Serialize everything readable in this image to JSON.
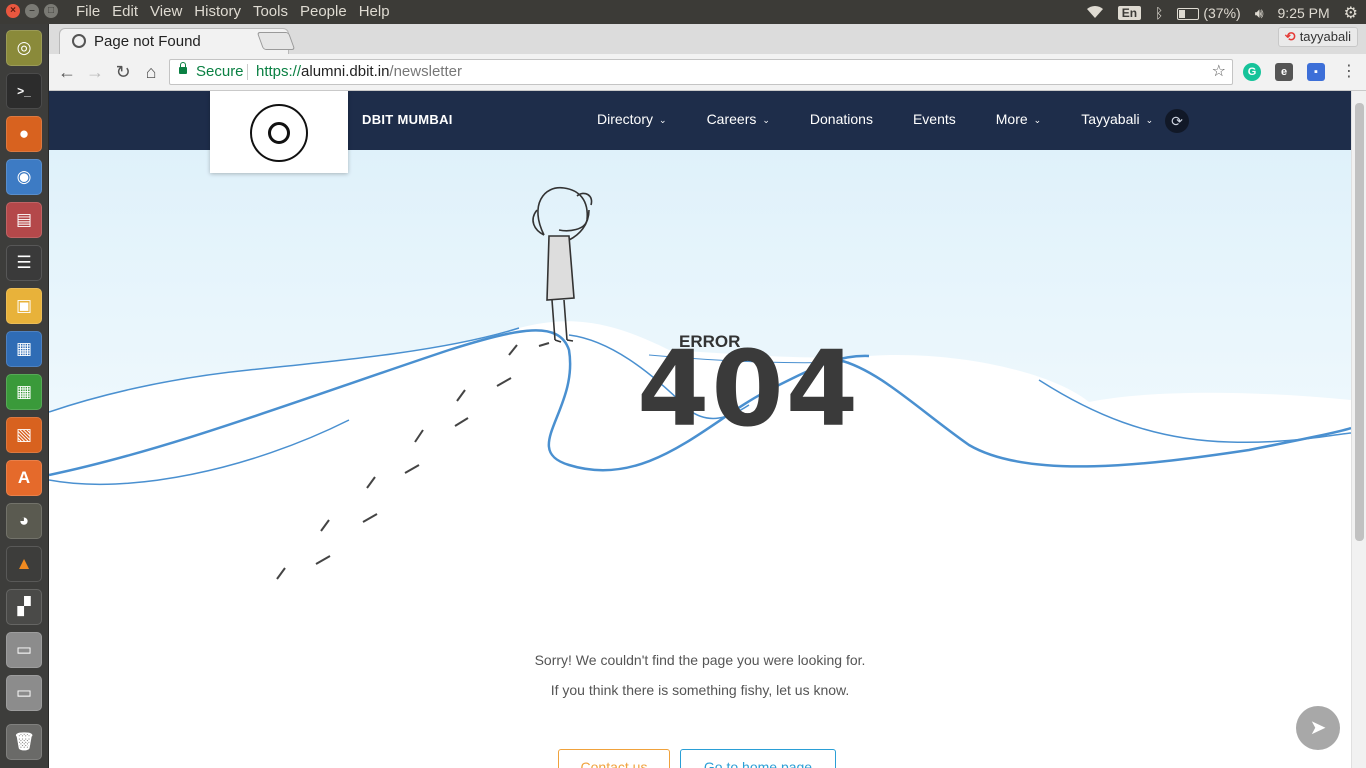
{
  "os": {
    "menus": [
      "File",
      "Edit",
      "View",
      "History",
      "Tools",
      "People",
      "Help"
    ],
    "keyboard": "En",
    "battery": "(37%)",
    "time": "9:25 PM"
  },
  "browser": {
    "tab_title": "Page not Found",
    "profile": "tayyabali",
    "secure_label": "Secure",
    "url_scheme": "https://",
    "url_host": "alumni.dbit.in",
    "url_path": "/newsletter"
  },
  "site": {
    "brand": "DBIT MUMBAI",
    "nav": [
      {
        "label": "Directory",
        "dropdown": true
      },
      {
        "label": "Careers",
        "dropdown": true
      },
      {
        "label": "Donations",
        "dropdown": false
      },
      {
        "label": "Events",
        "dropdown": false
      },
      {
        "label": "More",
        "dropdown": true
      },
      {
        "label": "Tayyabali",
        "dropdown": true
      }
    ]
  },
  "error": {
    "label": "ERROR",
    "code": "404",
    "message": "Sorry! We couldn't find the page you were looking for.",
    "submessage": "If you think there is something fishy, let us know.",
    "contact_button": "Contact us",
    "home_button": "Go to home page"
  },
  "colors": {
    "nav_bg": "#1e2d4a",
    "sky": "#e3f3fb",
    "wave": "#4a90d0",
    "contact": "#f0a23c",
    "home": "#2a9fd6"
  }
}
